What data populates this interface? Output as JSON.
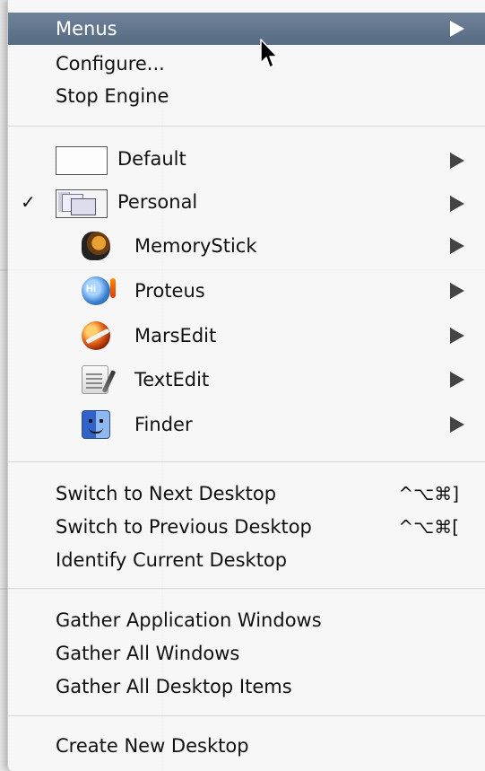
{
  "menu": {
    "items": [
      {
        "label": "Menus",
        "has_submenu": true,
        "highlighted": true
      },
      {
        "label": "Configure...",
        "has_submenu": false
      },
      {
        "label": "Stop Engine",
        "has_submenu": false
      }
    ],
    "desktops": [
      {
        "label": "Default",
        "checked": false,
        "has_submenu": true
      },
      {
        "label": "Personal",
        "checked": true,
        "check_glyph": "✓",
        "has_submenu": true
      }
    ],
    "apps": [
      {
        "label": "MemoryStick",
        "icon": "memorystick-icon"
      },
      {
        "label": "Proteus",
        "icon": "proteus-icon"
      },
      {
        "label": "MarsEdit",
        "icon": "marsedit-icon"
      },
      {
        "label": "TextEdit",
        "icon": "textedit-icon"
      },
      {
        "label": "Finder",
        "icon": "finder-icon"
      }
    ],
    "navigation": [
      {
        "label": "Switch to Next Desktop",
        "shortcut": "^⌥⌘]"
      },
      {
        "label": "Switch to Previous Desktop",
        "shortcut": "^⌥⌘["
      },
      {
        "label": "Identify Current Desktop",
        "shortcut": ""
      }
    ],
    "gather": [
      {
        "label": "Gather Application Windows"
      },
      {
        "label": "Gather All Windows"
      },
      {
        "label": "Gather All Desktop Items"
      }
    ],
    "create": {
      "label": "Create New Desktop"
    }
  },
  "colors": {
    "highlight": "#60748c",
    "menu_background": "#f8f8f8",
    "text": "#111111"
  }
}
